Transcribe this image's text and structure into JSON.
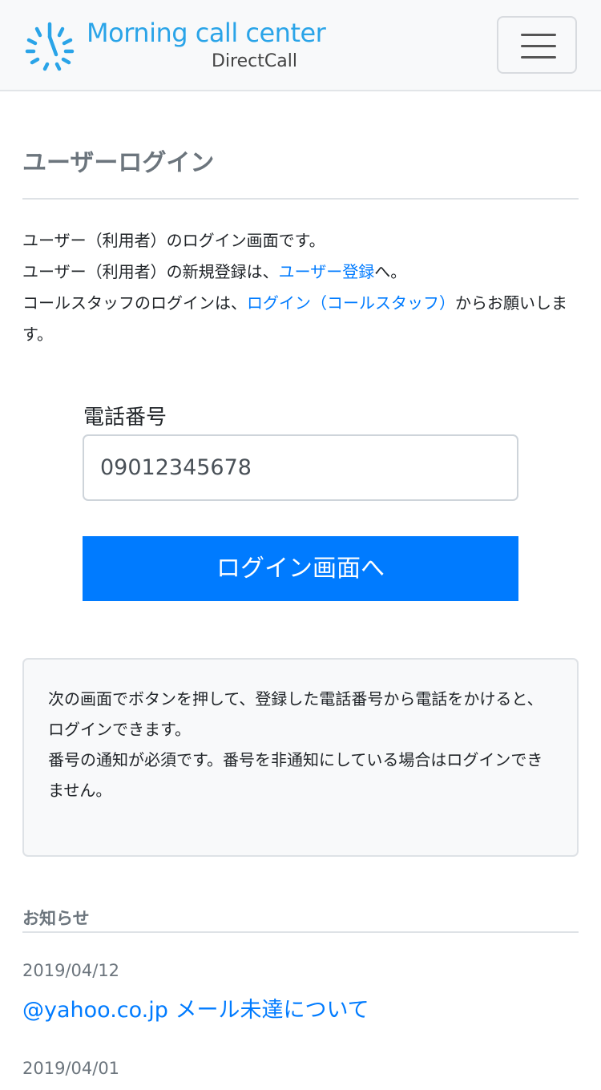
{
  "header": {
    "logo_title": "Morning call center",
    "logo_subtitle": "DirectCall",
    "brand_color": "#2aa4e8",
    "menu_icon": "hamburger-menu-icon"
  },
  "page": {
    "title": "ユーザーログイン"
  },
  "intro": {
    "line1": "ユーザー（利用者）のログイン画面です。",
    "line2_prefix": "ユーザー（利用者）の新規登録は、",
    "line2_link": "ユーザー登録",
    "line2_suffix": "へ。",
    "line3_prefix": "コールスタッフのログインは、",
    "line3_link": "ログイン（コールスタッフ）",
    "line3_suffix": "からお願いします。"
  },
  "form": {
    "phone_label": "電話番号",
    "phone_value": "09012345678",
    "submit_label": "ログイン画面へ",
    "accent_color": "#007bff"
  },
  "notice": {
    "paragraph1": "次の画面でボタンを押して、登録した電話番号から電話をかけると、ログインできます。",
    "paragraph2": "番号の通知が必須です。番号を非通知にしている場合はログインできません。"
  },
  "news": {
    "title": "お知らせ",
    "items": [
      {
        "date": "2019/04/12",
        "title": "@yahoo.co.jp メール未達について"
      },
      {
        "date": "2019/04/01",
        "title": ""
      }
    ]
  }
}
